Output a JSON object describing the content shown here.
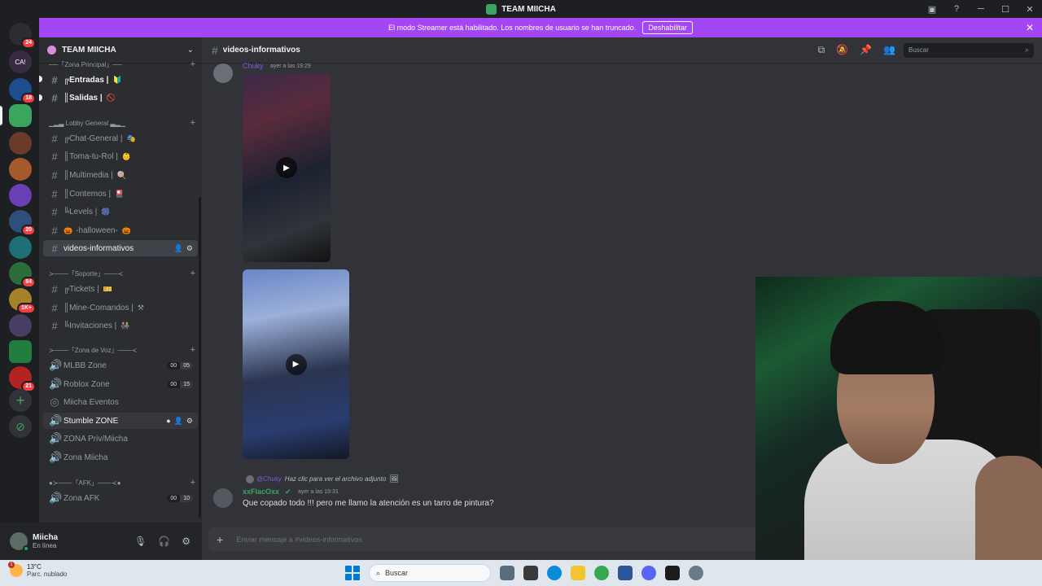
{
  "window": {
    "title": "TEAM MIICHA"
  },
  "banner": {
    "text": "El modo Streamer está habilitado. Los nombres de usuario se han truncado.",
    "button": "Deshabilitar"
  },
  "servers": {
    "badges": [
      "24",
      "18",
      "20",
      "84",
      "1K+",
      "21"
    ],
    "label_ca": "CA!"
  },
  "guild": {
    "name": "TEAM MIICHA"
  },
  "categories": {
    "zona_principal": "──「Zona Principal」──",
    "lobby": "▁▂▃ Lobby General ▃▂▁",
    "soporte": "≻───「Soporte」───≺",
    "voz": "≻───「Zona de Voz」───≺",
    "afk": "●≻───「AFK」───≺●"
  },
  "channels": {
    "entradas": "╔Entradas |",
    "salidas": "║Salidas |",
    "chat_general": "╔Chat-General |",
    "toma_tu_rol": "║Toma-tu-Rol |",
    "multimedia": "║Multimedia |",
    "contemos": "║Contemos |",
    "levels": "╚Levels |",
    "halloween": "-halloween-",
    "videos": "videos-informativos",
    "tickets": "╔Tickets |",
    "mine": "║Mine-Comandos |",
    "invitaciones": "╚Invitaciones |"
  },
  "voice": {
    "mlbb": {
      "name": "MLBB Zone",
      "a": "00",
      "b": "05"
    },
    "roblox": {
      "name": "Roblox Zone",
      "a": "00",
      "b": "15"
    },
    "eventos": {
      "name": "Miicha Eventos"
    },
    "stumble": {
      "name": "Stumble ZONE"
    },
    "priv": {
      "name": "ZONA Priv/Miicha"
    },
    "miicha": {
      "name": "Zona Miicha"
    },
    "afk": {
      "name": "Zona AFK",
      "a": "00",
      "b": "10"
    }
  },
  "user": {
    "name": "Miicha",
    "status": "En línea"
  },
  "channel_header": {
    "name": "videos-informativos",
    "search_placeholder": "Buscar"
  },
  "messages": {
    "first": {
      "author": "Chuky",
      "time": "ayer a las 19:29"
    },
    "reply": {
      "ref_author": "@Chuky",
      "ref_text": "Haz clic para ver el archivo adjunto",
      "author": "xxFlacOxx",
      "time": "ayer a las 19:31",
      "text": "Que copado todo !!! pero me llamo la atención es un tarro de pintura?"
    }
  },
  "composer": {
    "placeholder": "Enviar mensaje a #videos-informativos"
  },
  "taskbar": {
    "temp": "13°C",
    "weather": "Parc. nublado",
    "weather_badge": "1",
    "search": "Buscar"
  },
  "colors": {
    "accent": "#a347f5",
    "online": "#23a559",
    "username_green": "#3ba55d",
    "mention": "#7b5fdb"
  }
}
